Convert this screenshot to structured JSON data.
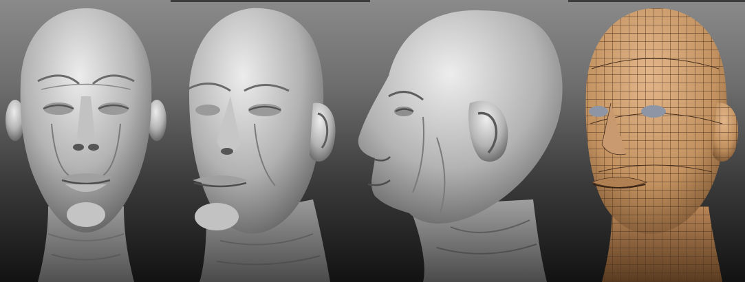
{
  "scene": {
    "background_top": "#8a8a8a",
    "background_bottom": "#121212",
    "clay_color": "#b9b9b9",
    "clay_highlight": "#e6e6e6",
    "clay_shadow": "#5a5a5a",
    "skin_color": "#c99a70",
    "wire_color": "#4a3220",
    "eye_color": "#8e96a6"
  },
  "views": [
    {
      "name": "front-view",
      "material": "clay"
    },
    {
      "name": "three-quarter-view",
      "material": "clay"
    },
    {
      "name": "profile-view",
      "material": "clay"
    },
    {
      "name": "wireframe-view",
      "material": "polypaint-wireframe"
    }
  ]
}
